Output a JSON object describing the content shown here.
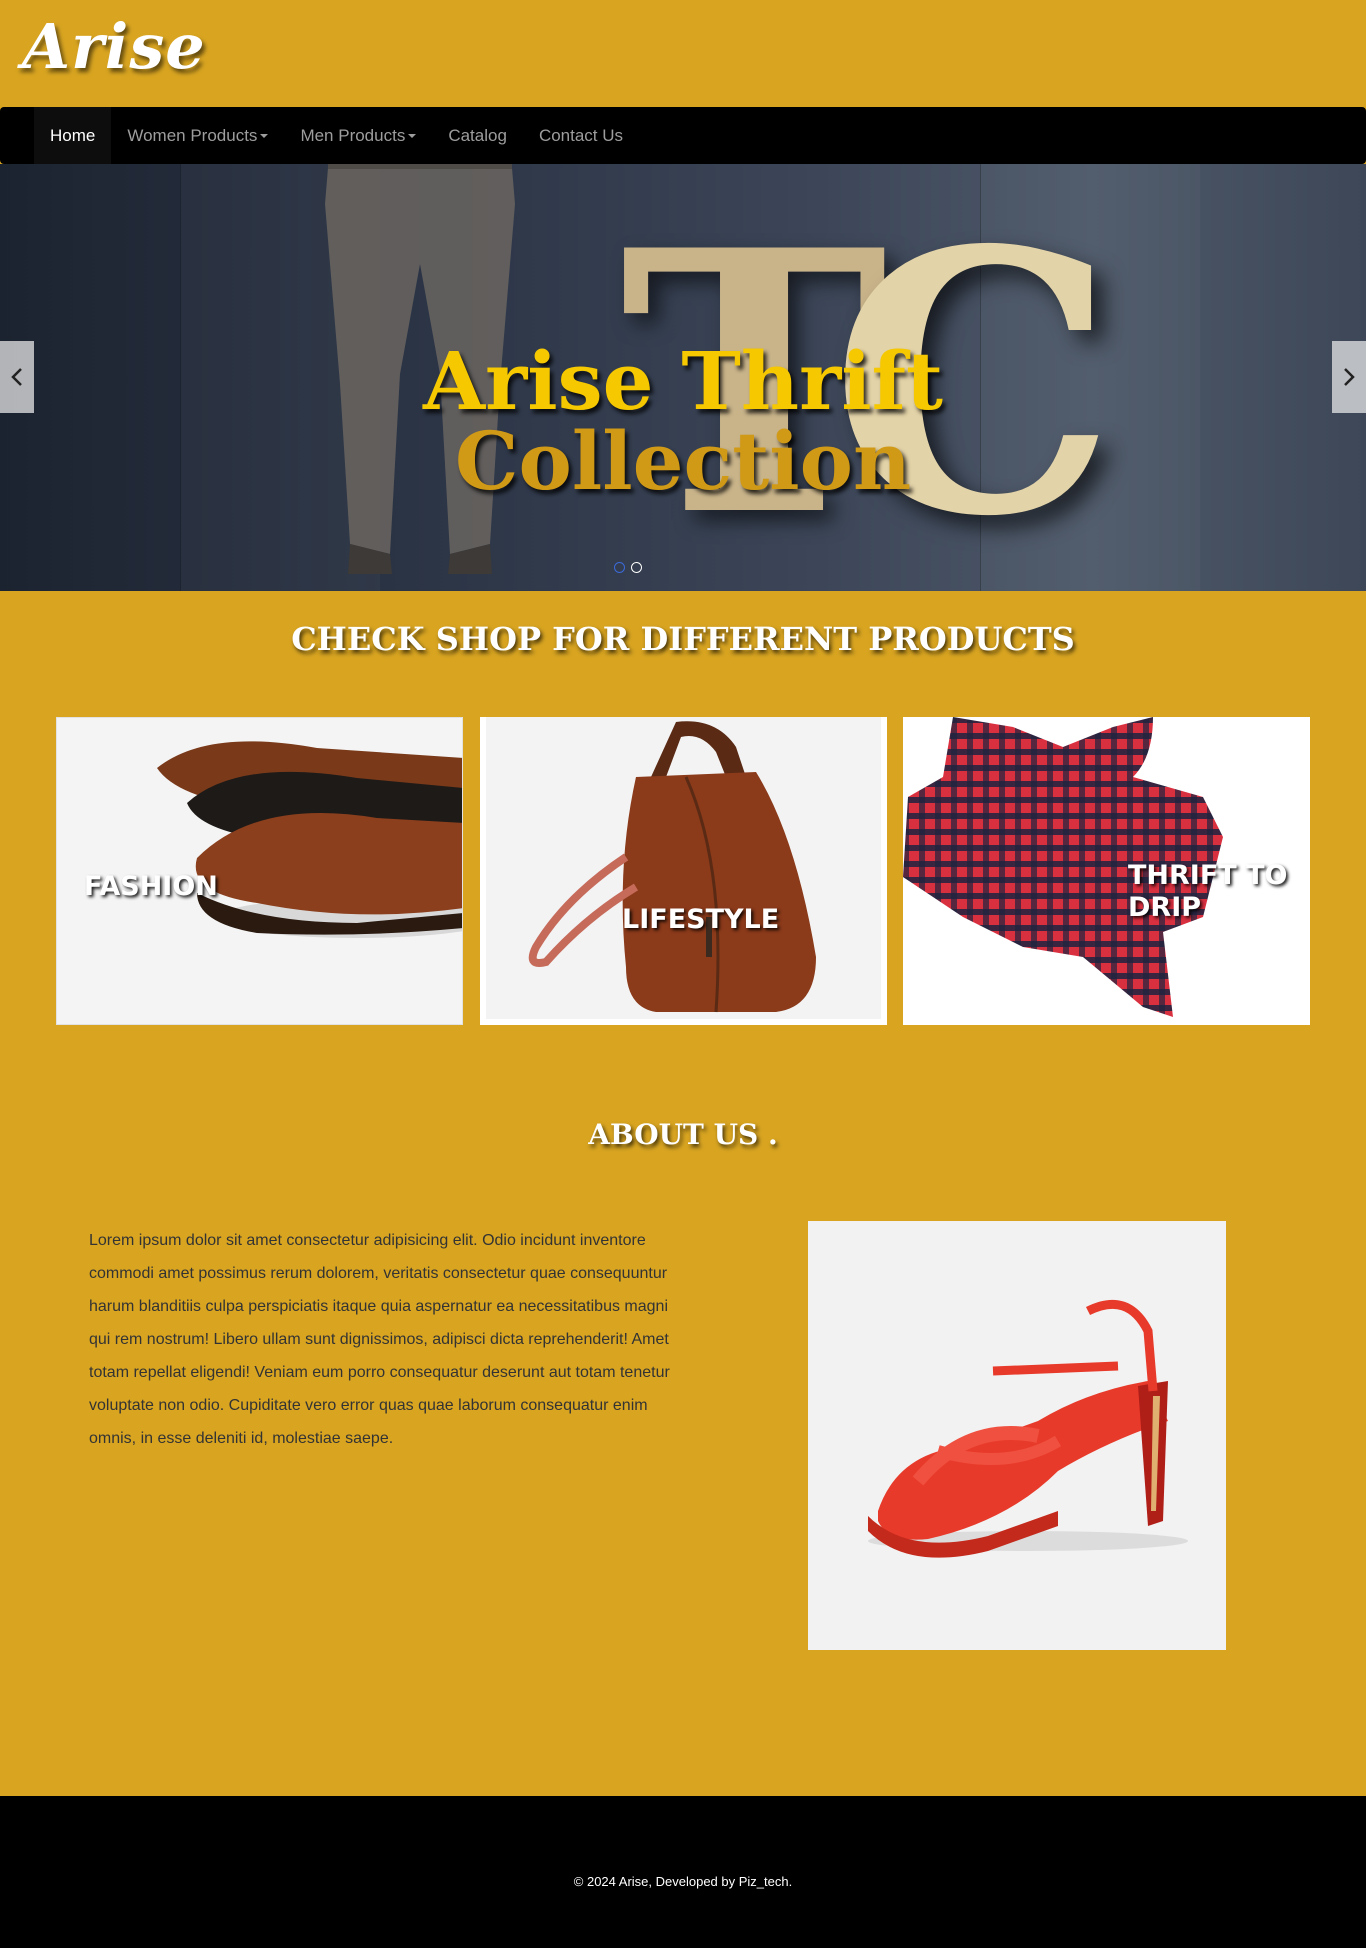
{
  "brand": {
    "logo": "Arise"
  },
  "nav": {
    "items": [
      {
        "label": "Home",
        "active": true,
        "dropdown": false
      },
      {
        "label": "Women Products",
        "active": false,
        "dropdown": true
      },
      {
        "label": "Men Products",
        "active": false,
        "dropdown": true
      },
      {
        "label": "Catalog",
        "active": false,
        "dropdown": false
      },
      {
        "label": "Contact Us",
        "active": false,
        "dropdown": false
      }
    ]
  },
  "carousel": {
    "line1": "Arise Thrift",
    "line2": "Collection",
    "slide_count": 2,
    "active_slide": 1,
    "prev_icon": "chevron-left-icon",
    "next_icon": "chevron-right-icon"
  },
  "products": {
    "heading": "CHECK SHOP FOR DIFFERENT PRODUCTS",
    "cards": [
      {
        "label": "FASHION",
        "image": "leather-shoes"
      },
      {
        "label": "LIFESTYLE",
        "image": "leather-bag"
      },
      {
        "label": "THRIFT TO DRIP",
        "image": "plaid-shirt"
      }
    ]
  },
  "about": {
    "heading": "ABOUT US .",
    "text": "Lorem ipsum dolor sit amet consectetur adipisicing elit. Odio incidunt inventore commodi amet possimus rerum dolorem, veritatis consectetur quae consequuntur harum blanditiis culpa perspiciatis itaque quia aspernatur ea necessitatibus magni qui rem nostrum! Libero ullam sunt dignissimos, adipisci dicta reprehenderit! Amet totam repellat eligendi! Veniam eum porro consequatur deserunt aut totam tenetur voluptate non odio. Cupiditate vero error quas quae laborum consequatur enim omnis, in esse deleniti id, molestiae saepe.",
    "image": "red-high-heel-sandal"
  },
  "footer": {
    "text": "© 2024 Arise, Developed by Piz_tech."
  },
  "colors": {
    "page_bg": "#d9a521",
    "navbar_bg": "#000000",
    "footer_bg": "#000000",
    "hero_gold": "#f5c800"
  }
}
